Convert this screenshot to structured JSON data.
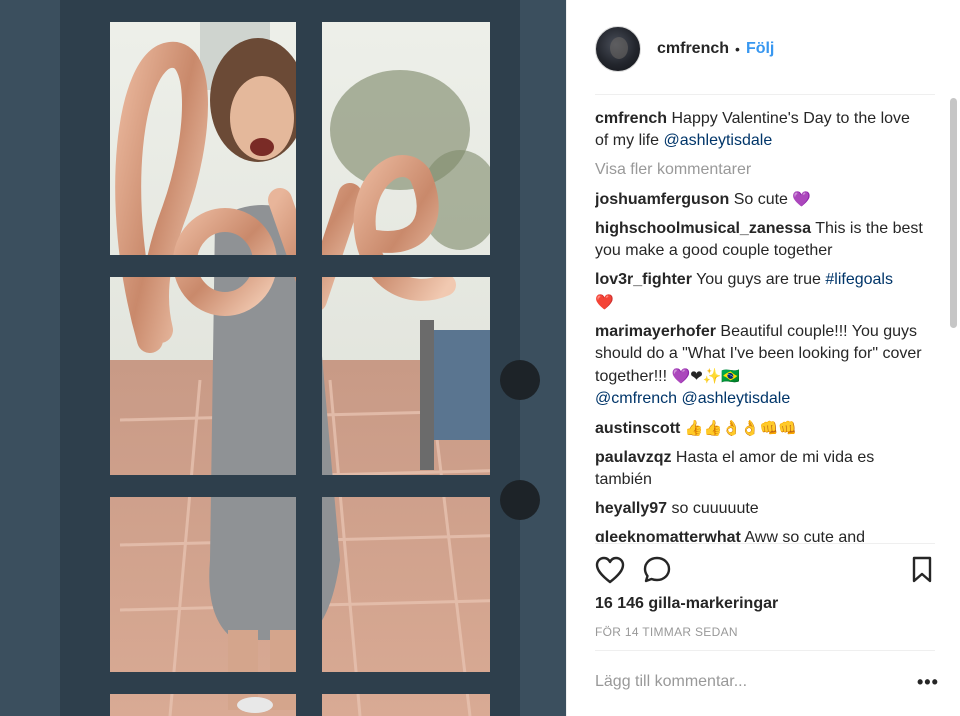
{
  "post": {
    "author": "cmfrench",
    "separator": "•",
    "follow_label": "Följ",
    "caption": {
      "user": "cmfrench",
      "text": "Happy Valentine's Day to the love of my life",
      "mention": "@ashleytisdale"
    },
    "show_more": "Visa fler kommentarer",
    "comments": [
      {
        "user": "joshuamferguson",
        "text": "So cute",
        "emoji": "💜"
      },
      {
        "user": "highschoolmusical_zanessa",
        "text": "This is the best you make a good couple together",
        "emoji": ""
      },
      {
        "user": "lov3r_fighter",
        "text": "You guys are true",
        "tag": "#lifegoals",
        "emoji": "❤️"
      },
      {
        "user": "marimayerhofer",
        "text": "Beautiful couple!!! You guys should do a \"What I've been looking for\" cover together!!!",
        "emoji": "💜❤✨🇧🇷",
        "mentions": "@cmfrench @ashleytisdale"
      },
      {
        "user": "austinscott",
        "text": "",
        "emoji": "👍👍👌👌👊👊"
      },
      {
        "user": "paulavzqz",
        "text": "Hasta el amor de mi vida es también",
        "emoji": ""
      },
      {
        "user": "heyally97",
        "text": "so cuuuuute",
        "emoji": ""
      },
      {
        "user": "gleeknomatterwhat",
        "text": "Aww so cute and",
        "emoji": ""
      }
    ],
    "likes": "16 146 gilla-markeringar",
    "timestamp": "FÖR 14 TIMMAR SEDAN",
    "add_comment_placeholder": "Lägg till kommentar...",
    "options": "•••"
  },
  "icons": {
    "like": "heart-outline-icon",
    "comment": "comment-bubble-icon",
    "save": "bookmark-icon",
    "options": "more-options-icon"
  },
  "colors": {
    "link": "#003569",
    "follow": "#3897f0",
    "muted": "#999999",
    "text": "#262626"
  }
}
